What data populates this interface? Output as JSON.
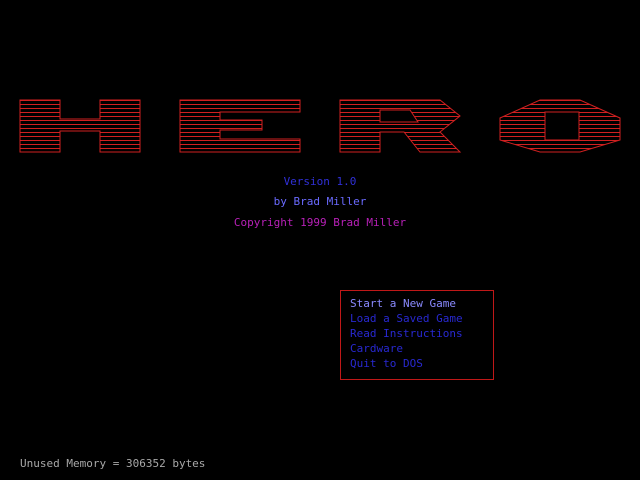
{
  "title": {
    "logo_text": "HERO"
  },
  "info": {
    "version": "Version 1.0",
    "author": "by Brad Miller",
    "copyright": "Copyright 1999 Brad Miller"
  },
  "menu": {
    "items": [
      {
        "label": "Start a New Game",
        "selected": true
      },
      {
        "label": "Load a Saved Game",
        "selected": false
      },
      {
        "label": "Read Instructions",
        "selected": false
      },
      {
        "label": "Cardware",
        "selected": false
      },
      {
        "label": "Quit to DOS",
        "selected": false
      }
    ]
  },
  "status": {
    "memory": "Unused Memory = 306352 bytes"
  },
  "colors": {
    "background": "#000000",
    "logo_red": "#d02020",
    "version_blue": "#3030d8",
    "author_blue": "#6a6aff",
    "copyright_magenta": "#b820b8",
    "menu_border": "#c01818",
    "menu_selected": "#8a8aff",
    "menu_item": "#2828d0",
    "memory_gray": "#a8a8a8"
  }
}
